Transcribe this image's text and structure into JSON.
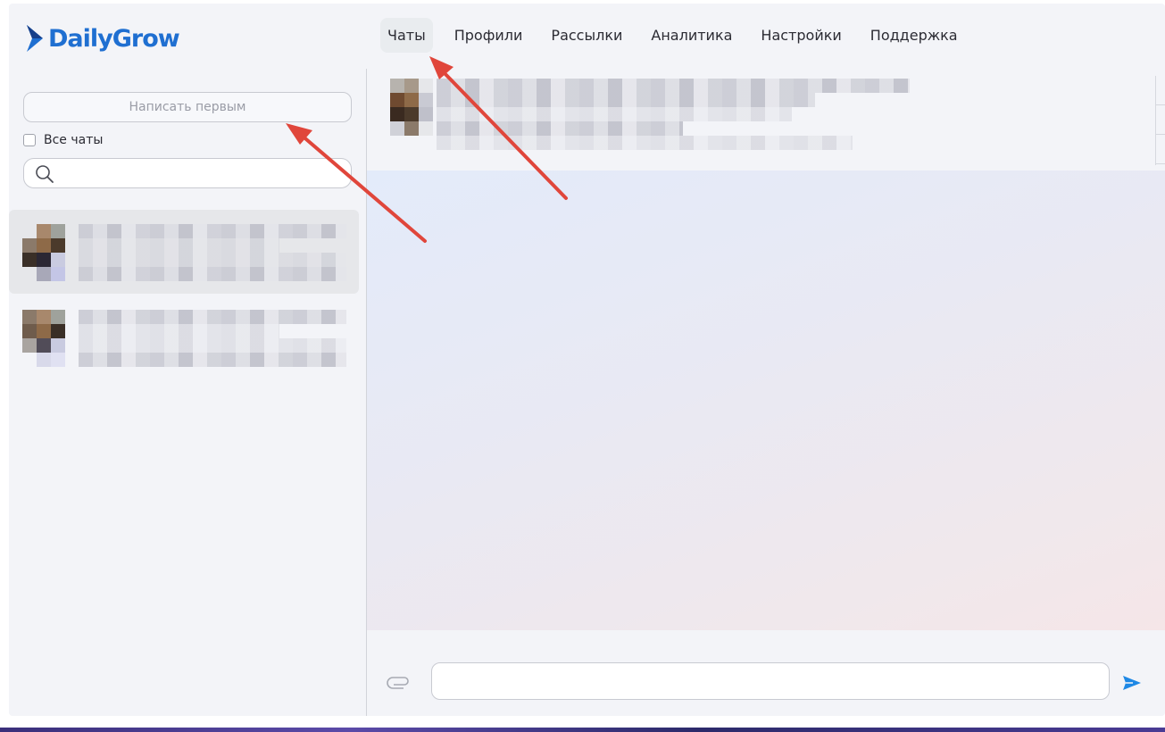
{
  "brand": {
    "name": "DailyGrow",
    "color": "#1f6fd1"
  },
  "nav": {
    "items": [
      {
        "label": "Чаты",
        "active": true
      },
      {
        "label": "Профили"
      },
      {
        "label": "Рассылки"
      },
      {
        "label": "Аналитика"
      },
      {
        "label": "Настройки"
      },
      {
        "label": "Поддержка"
      }
    ]
  },
  "sidebar": {
    "write_first_label": "Написать первым",
    "all_chats_label": "Все чаты",
    "all_chats_checked": false,
    "search": {
      "placeholder": "",
      "value": "",
      "icon": "search-icon"
    },
    "chats": [
      {
        "selected": true,
        "content": "blurred"
      },
      {
        "selected": false,
        "content": "blurred"
      }
    ]
  },
  "conversation": {
    "header_content": "blurred",
    "composer": {
      "placeholder": "",
      "value": "",
      "attach_icon": "paperclip-icon",
      "send_icon": "send-icon"
    }
  },
  "annotations": {
    "arrow_color": "#e0463b",
    "count": 2
  }
}
